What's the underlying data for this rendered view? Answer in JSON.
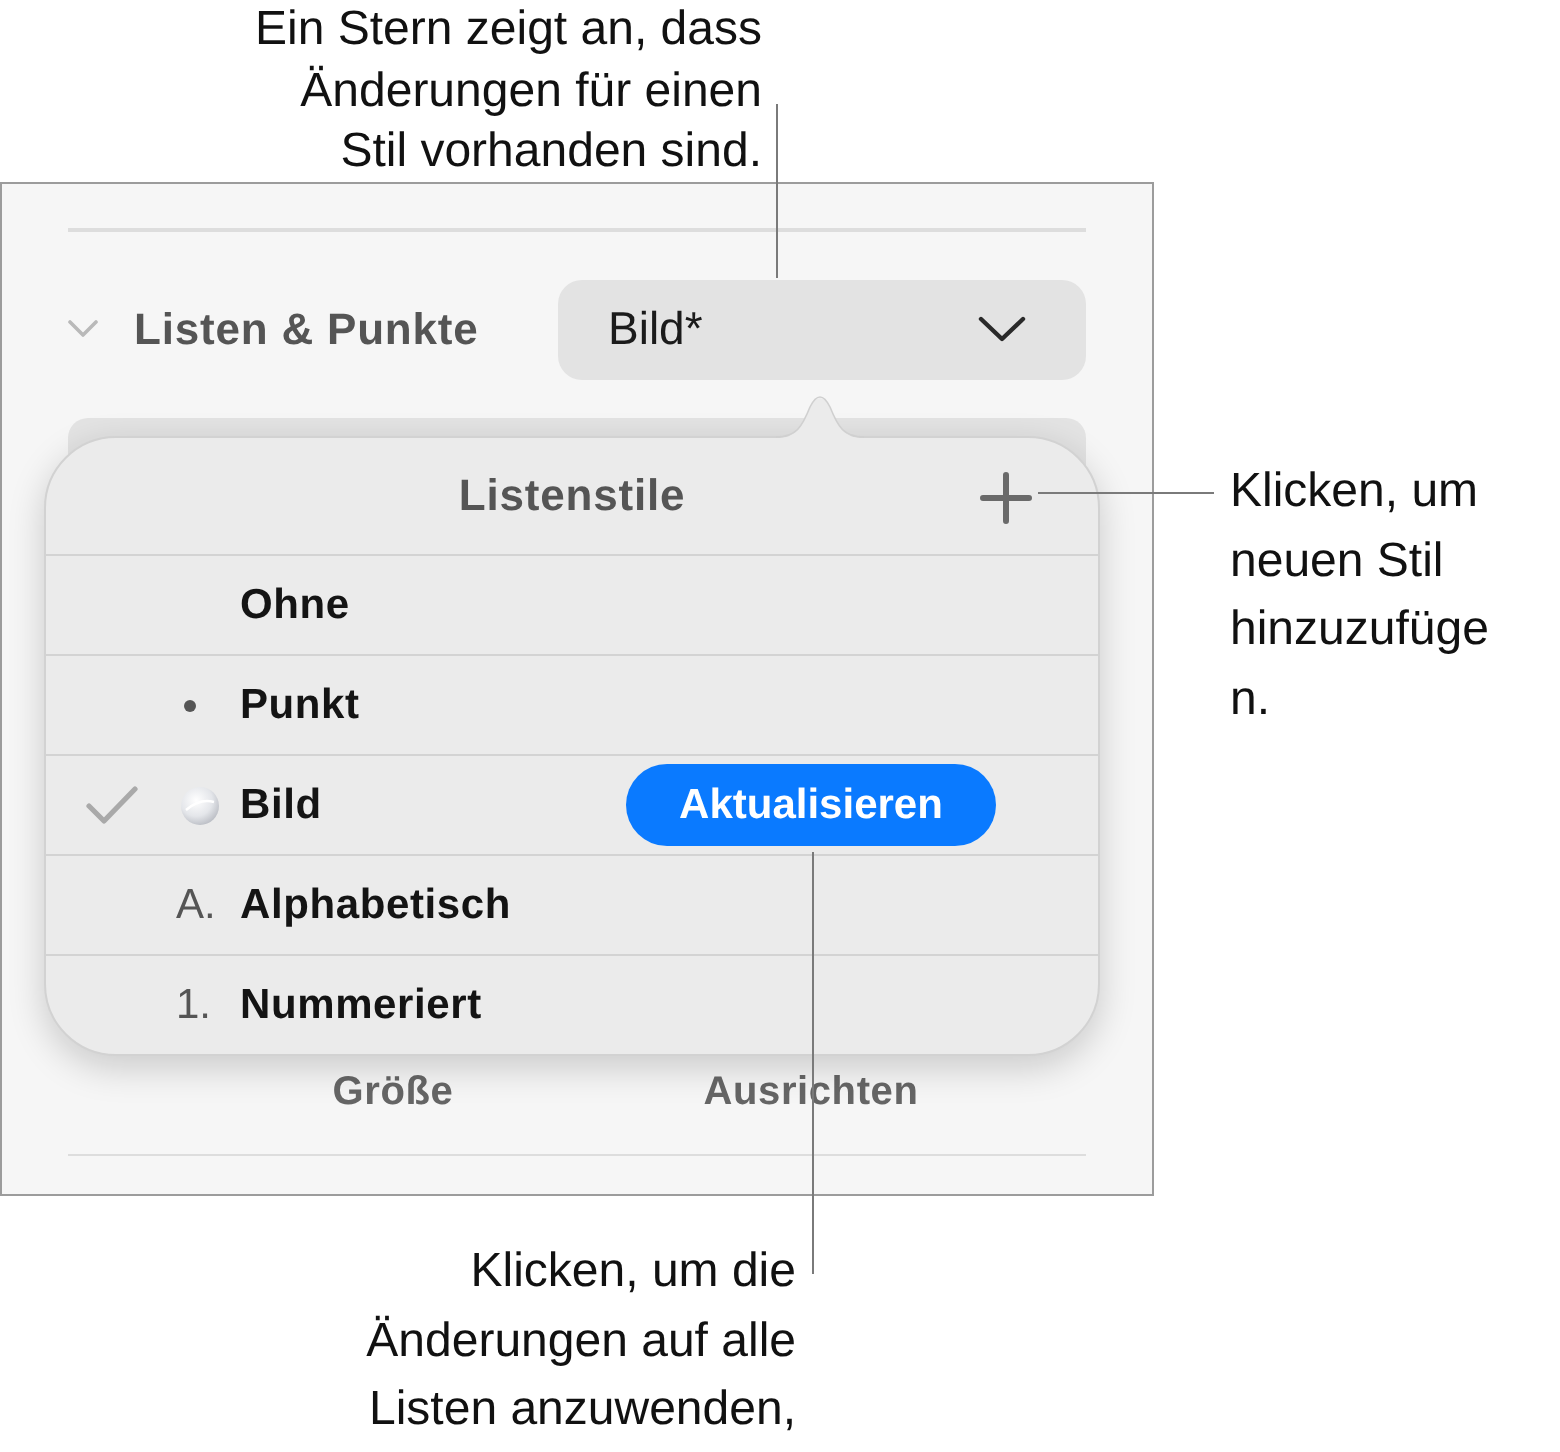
{
  "callouts": [
    {
      "lines": [
        "Ein Stern zeigt an, dass",
        "Änderungen für einen",
        "Stil vorhanden sind."
      ]
    },
    {
      "lines": [
        "Klicken, um",
        "neuen Stil",
        "hinzuzufüge",
        "n."
      ]
    },
    {
      "lines": [
        "Klicken, um die",
        "Änderungen auf alle",
        "Listen anzuwenden,"
      ]
    }
  ],
  "inspector": {
    "section": {
      "title": "Listen & Punkte",
      "expanded": true,
      "style_popup": {
        "value": "Bild*"
      }
    },
    "popover": {
      "title": "Listenstile",
      "styles": [
        {
          "kind": "none",
          "label": "Ohne",
          "selected": false
        },
        {
          "kind": "bullet",
          "label": "Punkt",
          "selected": false
        },
        {
          "kind": "image",
          "label": "Bild",
          "selected": true,
          "action": "Aktualisieren"
        },
        {
          "kind": "letter",
          "marker": "A.",
          "label": "Alphabetisch",
          "selected": false
        },
        {
          "kind": "number",
          "marker": "1.",
          "label": "Nummeriert",
          "selected": false
        }
      ]
    },
    "field_labels": [
      "Größe",
      "Ausrichten"
    ]
  }
}
